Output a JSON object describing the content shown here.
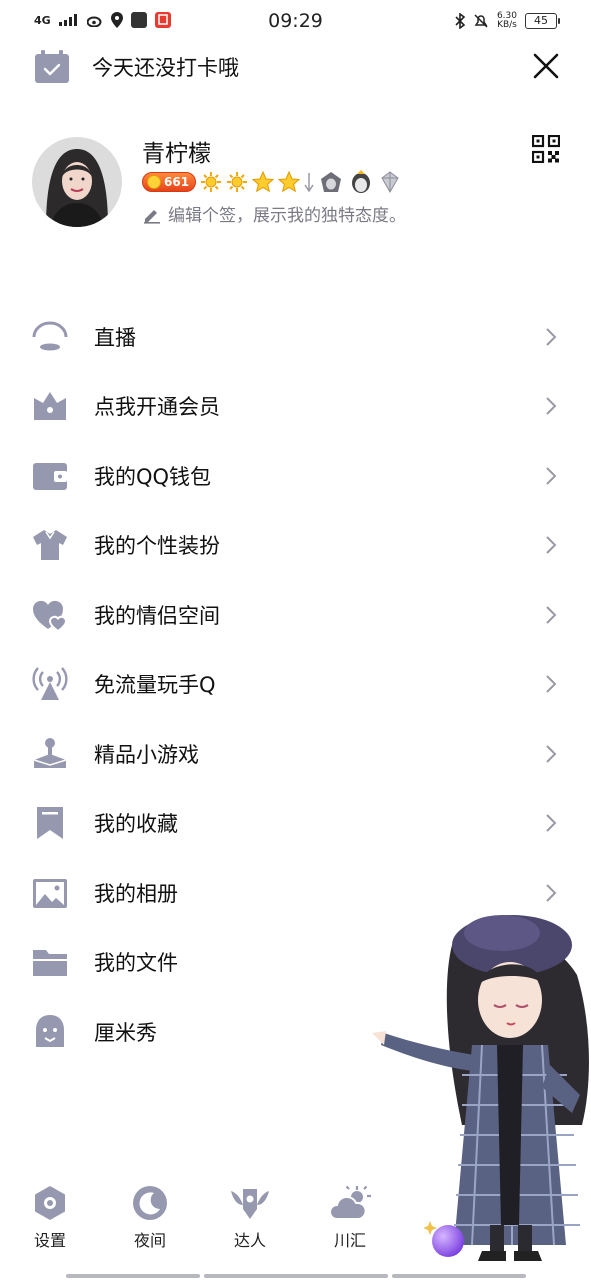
{
  "status_bar": {
    "network": "4G",
    "carrier_tag": "du",
    "time": "09:29",
    "speed_value": "6.30",
    "speed_unit": "KB/s",
    "battery": "45"
  },
  "checkin": {
    "text": "今天还没打卡哦"
  },
  "profile": {
    "nickname": "青柠檬",
    "level": "661",
    "signature": "编辑个签，展示我的独特态度。"
  },
  "menu": {
    "items": [
      {
        "label": "直播",
        "icon": "live-icon",
        "chevron": true
      },
      {
        "label": "点我开通会员",
        "icon": "vip-crown-icon",
        "chevron": true
      },
      {
        "label": "我的QQ钱包",
        "icon": "wallet-icon",
        "chevron": true
      },
      {
        "label": "我的个性装扮",
        "icon": "shirt-icon",
        "chevron": true
      },
      {
        "label": "我的情侣空间",
        "icon": "couple-heart-icon",
        "chevron": true
      },
      {
        "label": "免流量玩手Q",
        "icon": "signal-tower-icon",
        "chevron": true
      },
      {
        "label": "精品小游戏",
        "icon": "joystick-icon",
        "chevron": true
      },
      {
        "label": "我的收藏",
        "icon": "bookmark-icon",
        "chevron": true
      },
      {
        "label": "我的相册",
        "icon": "photo-album-icon",
        "chevron": true
      },
      {
        "label": "我的文件",
        "icon": "folder-icon",
        "chevron": false
      },
      {
        "label": "厘米秀",
        "icon": "cmshow-icon",
        "chevron": false
      }
    ]
  },
  "bottom_bar": {
    "settings": "设置",
    "night": "夜间",
    "talent": "达人",
    "chuanhui": "川汇"
  },
  "colors": {
    "icon": "#9698b0",
    "accent": "#e6431a"
  }
}
